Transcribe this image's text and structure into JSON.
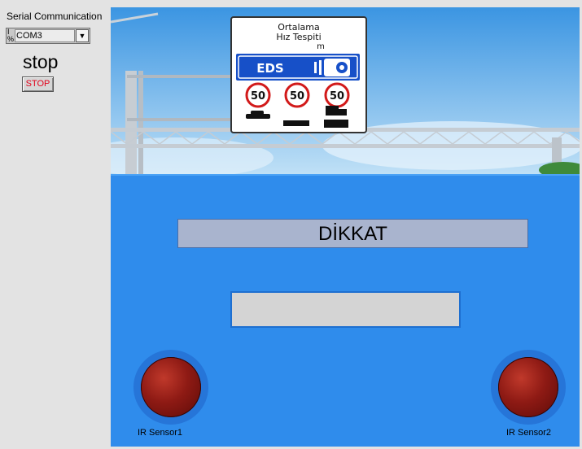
{
  "serial": {
    "label": "Serial Communication",
    "io_icon": "I/O",
    "value": "COM3",
    "dropdown_icon": "▼"
  },
  "stop": {
    "label": "stop",
    "button_label": "STOP"
  },
  "photo": {
    "sign_line1": "Ortalama",
    "sign_line2": "Hız Tespiti",
    "sign_line3": "m",
    "eds_text": "EDS",
    "speed_limits": [
      "50",
      "50",
      "50"
    ]
  },
  "panel": {
    "warning_text": "DİKKAT",
    "display_value": ""
  },
  "sensors": {
    "sensor1_label": "IR Sensor1",
    "sensor2_label": "IR Sensor2"
  },
  "colors": {
    "panel": "#2f8cec",
    "led_off": "#8e1a14",
    "stop_text": "#e2001a"
  }
}
